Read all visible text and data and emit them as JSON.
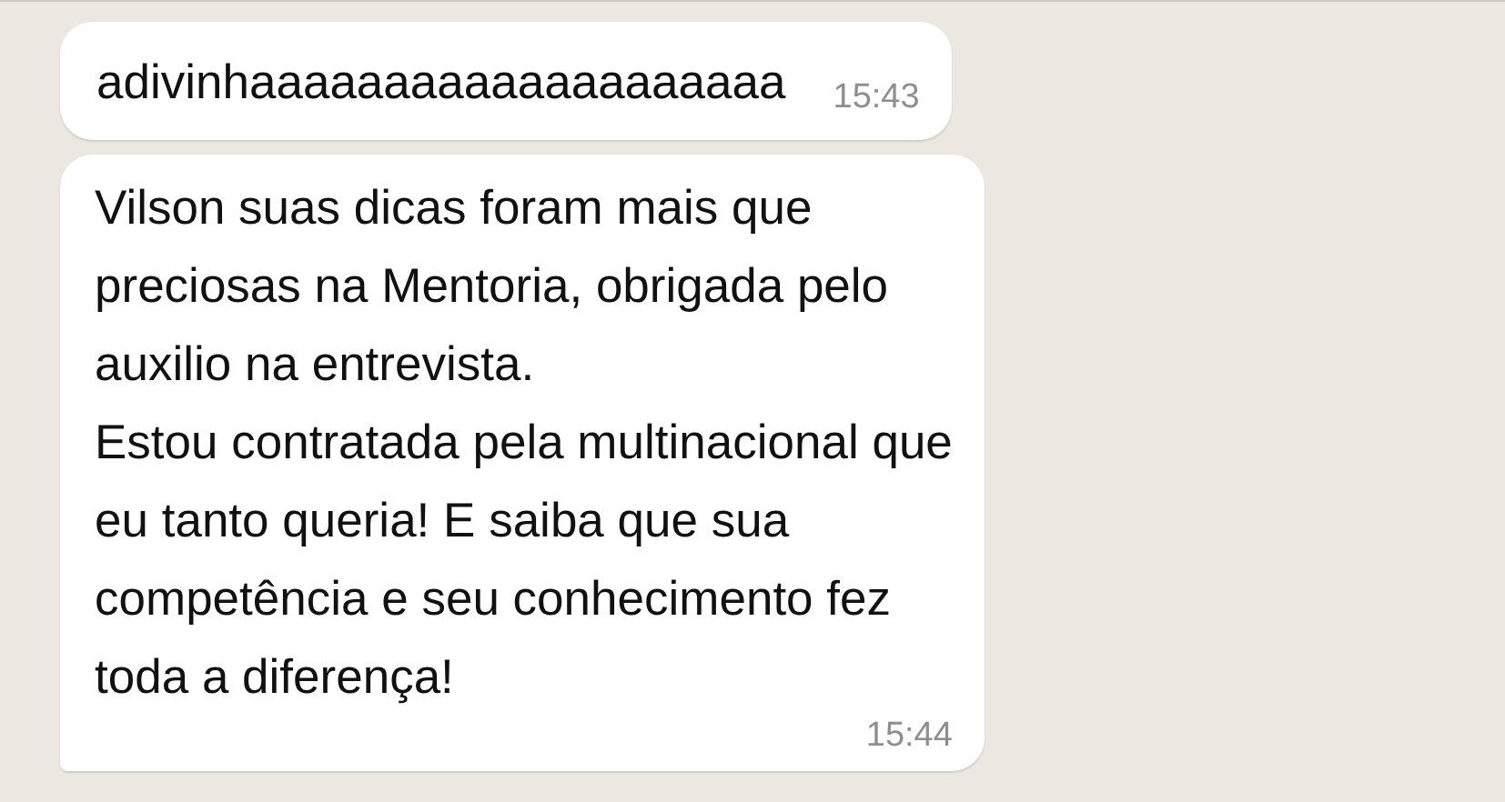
{
  "messages": [
    {
      "text": "adivinhaaaaaaaaaaaaaaaaaaaa",
      "time": "15:43",
      "tail": false
    },
    {
      "text": "Vilson suas dicas foram mais que\npreciosas na Mentoria, obrigada pelo\nauxilio na entrevista.\nEstou contratada pela multinacional que\neu tanto queria! E saiba que sua\ncompetência e seu conhecimento fez\ntoda a diferença!",
      "time": "15:44",
      "tail": true
    }
  ]
}
